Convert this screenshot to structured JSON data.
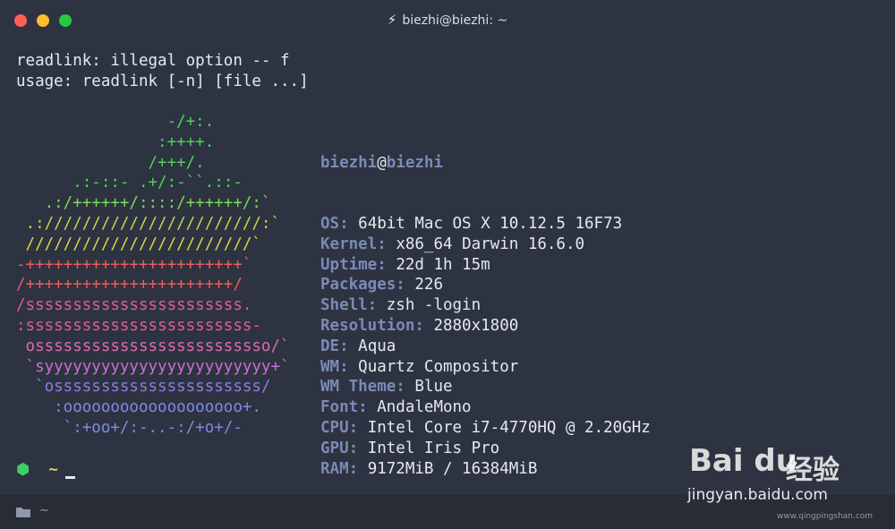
{
  "window": {
    "title": "biezhi@biezhi: ~",
    "colors": {
      "close": "#ff5f57",
      "minimize": "#febc2e",
      "maximize": "#28c840"
    }
  },
  "terminal": {
    "error_lines": [
      "readlink: illegal option -- f",
      "usage: readlink [-n] [file ...]"
    ],
    "logo_lines": [
      {
        "text": "                -/+:.",
        "color": "#50d25a"
      },
      {
        "text": "               :++++.",
        "color": "#50d25a"
      },
      {
        "text": "              /+++/.",
        "color": "#50d25a"
      },
      {
        "text": "      .:-::- .+/:-``.::-",
        "color": "#50d25a"
      },
      {
        "text": "   .:/++++++/::::/++++++/:`",
        "color": "#7ddb56"
      },
      {
        "text": " .:///////////////////////:`",
        "color": "#c8d84a"
      },
      {
        "text": " ////////////////////////`",
        "color": "#e0d44a"
      },
      {
        "text": "-+++++++++++++++++++++++`",
        "color": "#ef5c5c"
      },
      {
        "text": "/++++++++++++++++++++++/",
        "color": "#ef5c5c"
      },
      {
        "text": "/sssssssssssssssssssssss.",
        "color": "#e85c8c"
      },
      {
        "text": ":ssssssssssssssssssssssss-",
        "color": "#e85c8c"
      },
      {
        "text": " osssssssssssssssssssssssso/`",
        "color": "#e06ab0"
      },
      {
        "text": " `syyyyyyyyyyyyyyyyyyyyyyyy+`",
        "color": "#c86ed8"
      },
      {
        "text": "  `ossssssssssssssssssssss/",
        "color": "#8c7ee0"
      },
      {
        "text": "    :ooooooooooooooooooo+.",
        "color": "#7e8ae8"
      },
      {
        "text": "     `:+oo+/:-..-:/+o+/-",
        "color": "#7e8ae8"
      }
    ],
    "info": {
      "user": "biezhi",
      "at": "@",
      "host": "biezhi",
      "rows": [
        {
          "key": "OS:",
          "value": "64bit Mac OS X 10.12.5 16F73"
        },
        {
          "key": "Kernel:",
          "value": "x86_64 Darwin 16.6.0"
        },
        {
          "key": "Uptime:",
          "value": "22d 1h 15m"
        },
        {
          "key": "Packages:",
          "value": "226"
        },
        {
          "key": "Shell:",
          "value": "zsh -login"
        },
        {
          "key": "Resolution:",
          "value": "2880x1800"
        },
        {
          "key": "DE:",
          "value": "Aqua"
        },
        {
          "key": "WM:",
          "value": "Quartz Compositor"
        },
        {
          "key": "WM Theme:",
          "value": "Blue"
        },
        {
          "key": "Font:",
          "value": "AndaleMono"
        },
        {
          "key": "CPU:",
          "value": "Intel Core i7-4770HQ @ 2.20GHz"
        },
        {
          "key": "GPU:",
          "value": "Intel Iris Pro"
        },
        {
          "key": "RAM:",
          "value": "9172MiB / 16384MiB"
        }
      ]
    },
    "prompt": {
      "symbol": "⬢",
      "dir": "~"
    }
  },
  "statusbar": {
    "path": "~"
  },
  "watermark": {
    "brand": "Bai du",
    "brand_cn": "经验",
    "url": "jingyan.baidu.com",
    "small": "www.qingpingshan.com"
  }
}
